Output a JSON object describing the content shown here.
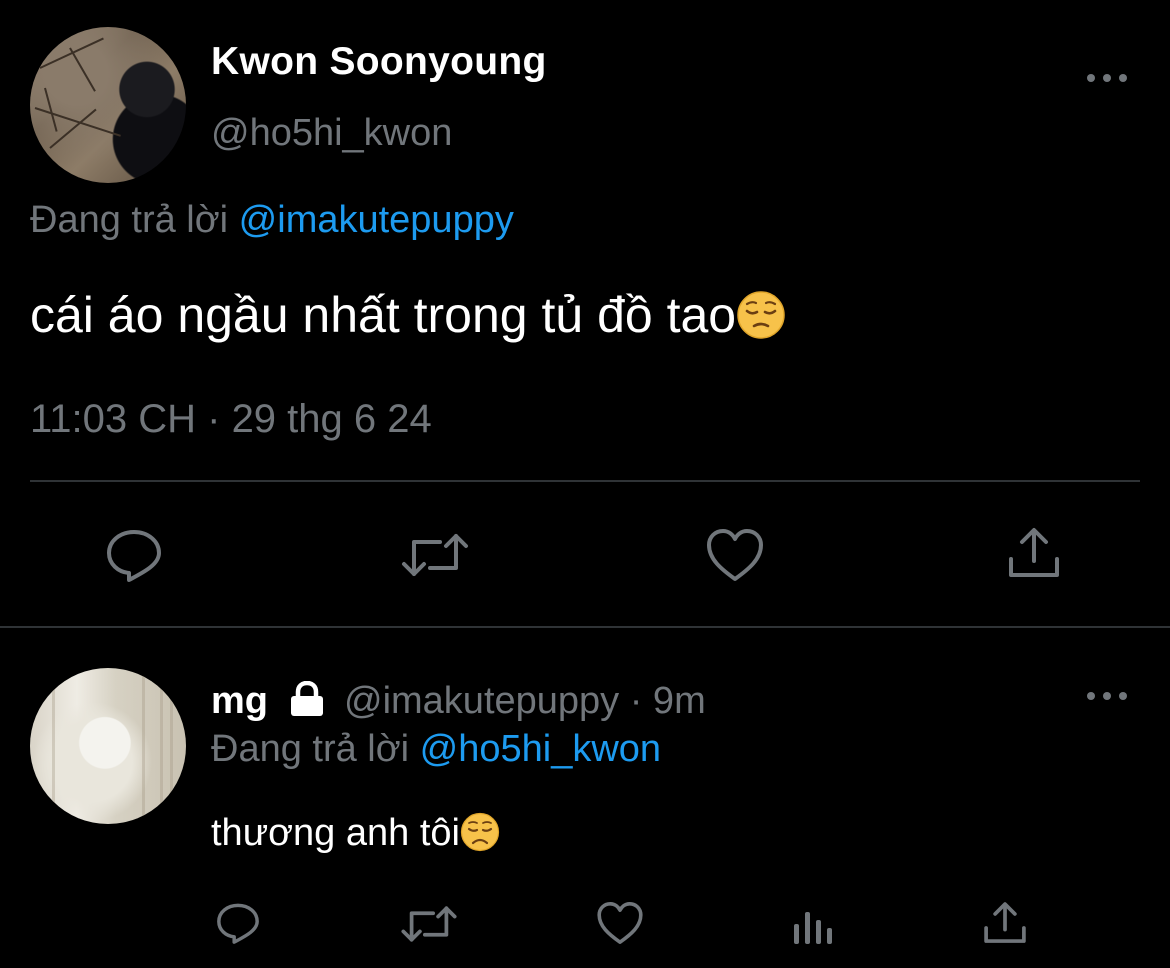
{
  "main_tweet": {
    "display_name": "Kwon Soonyoung",
    "handle": "@ho5hi_kwon",
    "reply_prefix": "Đang trả lời",
    "reply_to": "@imakutepuppy",
    "text": "cái áo ngầu nhất trong tủ đồ tao",
    "emoji": "pensive-face",
    "timestamp": "11:03 CH · 29 thg 6 24",
    "actions": [
      "reply-icon",
      "retweet-icon",
      "like-icon",
      "share-icon"
    ]
  },
  "reply_tweet": {
    "display_name": "mg",
    "protected_icon": "lock-icon",
    "handle_time": "@imakutepuppy · 9m",
    "reply_prefix": "Đang trả lời",
    "reply_to": "@ho5hi_kwon",
    "text": "thương anh tôi",
    "emoji": "disappointed-face",
    "actions": [
      "reply-icon",
      "retweet-icon",
      "like-icon",
      "analytics-icon",
      "share-icon"
    ]
  },
  "colors": {
    "background": "#000000",
    "primary_text": "#ffffff",
    "secondary_text": "#71767b",
    "accent": "#1d9bf0",
    "divider": "#2f3336"
  }
}
